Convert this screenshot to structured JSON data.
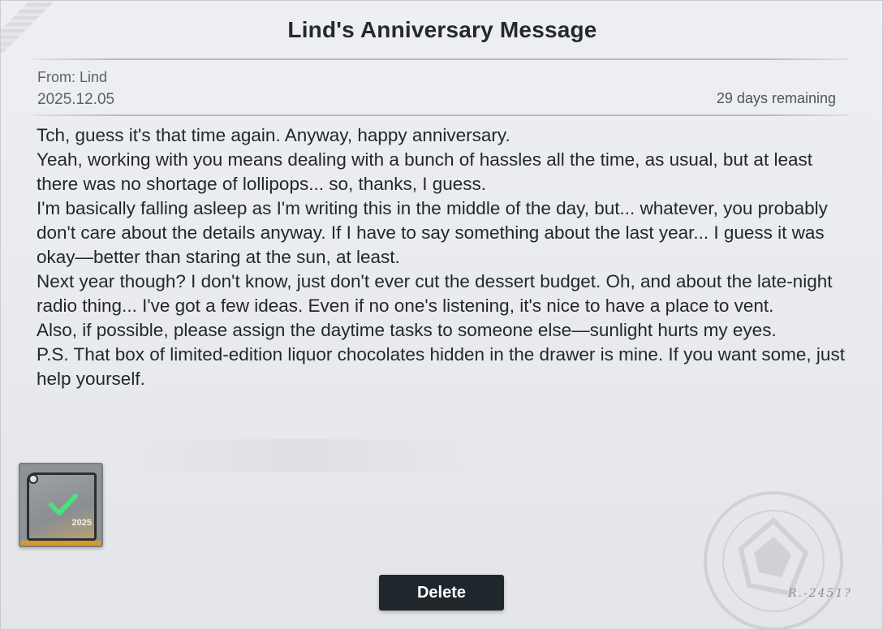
{
  "letter": {
    "title": "Lind's Anniversary Message",
    "from": "From: Lind",
    "date": "2025.12.05",
    "remaining": "29 days remaining",
    "paragraphs": [
      "Tch, guess it's that time again. Anyway, happy anniversary.",
      "Yeah, working with you means dealing with a bunch of hassles all the time, as usual, but at least there was no shortage of lollipops... so, thanks, I guess.",
      "I'm basically falling asleep as I'm writing this in the middle of the day, but... whatever, you probably don't care about the details anyway. If I have to say something about the last year... I guess it was okay—better than staring at the sun, at least.",
      "Next year though? I don't know, just don't ever cut the dessert budget. Oh, and about the late-night radio thing... I've got a few ideas. Even if no one's listening, it's nice to have a place to vent.",
      "Also, if possible, please assign the daytime tasks to someone else—sunlight hurts my eyes.",
      "P.S. That box of limited-edition liquor chocolates hidden in the drawer is mine. If you want some, just help yourself."
    ]
  },
  "attachment": {
    "year": "2025",
    "status_icon": "check-icon",
    "check_color": "#4ee07a"
  },
  "signature": "R.-2451?",
  "actions": {
    "delete_label": "Delete"
  },
  "colors": {
    "button_bg": "#1f272d",
    "text": "#20282e"
  }
}
